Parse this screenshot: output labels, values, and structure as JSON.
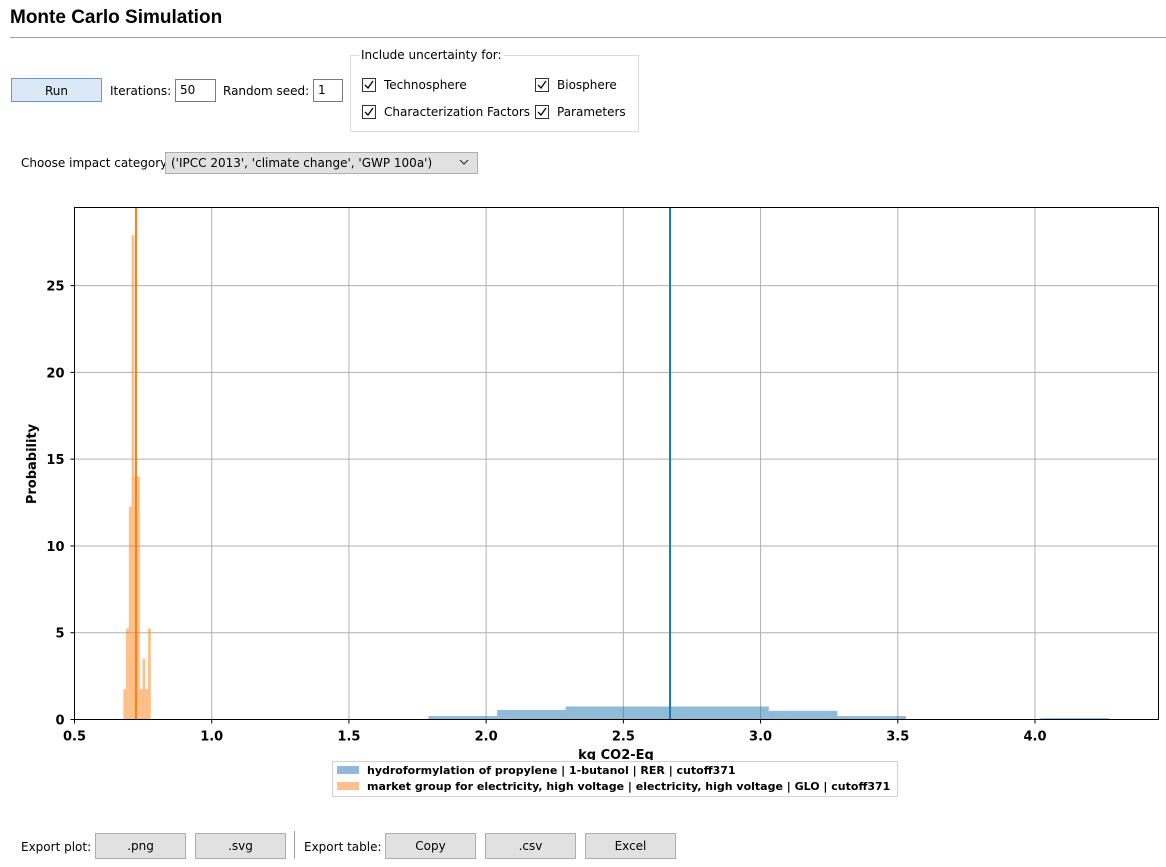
{
  "page": {
    "title": "Monte Carlo Simulation"
  },
  "controls": {
    "run_label": "Run",
    "iterations_label": "Iterations:",
    "iterations_value": "50",
    "seed_label": "Random seed:",
    "seed_value": "1"
  },
  "uncertainty": {
    "title": "Include uncertainty for:",
    "options": [
      {
        "label": "Technosphere",
        "checked": true
      },
      {
        "label": "Biosphere",
        "checked": true
      },
      {
        "label": "Characterization Factors",
        "checked": true
      },
      {
        "label": "Parameters",
        "checked": true
      }
    ]
  },
  "impact": {
    "label": "Choose impact category",
    "selected": "('IPCC 2013', 'climate change', 'GWP 100a')"
  },
  "export": {
    "plot_label": "Export plot:",
    "png_label": ".png",
    "svg_label": ".svg",
    "table_label": "Export table:",
    "copy_label": "Copy",
    "csv_label": ".csv",
    "excel_label": "Excel"
  },
  "chart_data": {
    "type": "bar",
    "xlabel": "kg CO2-Eq",
    "ylabel": "Probability",
    "xlim": [
      0.5,
      4.45
    ],
    "ylim": [
      0,
      29.5
    ],
    "xticks": [
      "0.5",
      "1.0",
      "1.5",
      "2.0",
      "2.5",
      "3.0",
      "3.5",
      "4.0"
    ],
    "yticks": [
      "0",
      "5",
      "10",
      "15",
      "20",
      "25"
    ],
    "grid": true,
    "legend_position": "bottom-center",
    "series": [
      {
        "name": "hydroformylation of propylene | 1-butanol | RER | cutoff371",
        "color": "#1f77b4",
        "mean": 2.67,
        "bins": [
          {
            "x0": 1.79,
            "x1": 2.04,
            "y": 0.2
          },
          {
            "x0": 2.04,
            "x1": 2.29,
            "y": 0.55
          },
          {
            "x0": 2.29,
            "x1": 3.03,
            "y": 0.75
          },
          {
            "x0": 3.03,
            "x1": 3.28,
            "y": 0.5
          },
          {
            "x0": 3.28,
            "x1": 3.53,
            "y": 0.2
          },
          {
            "x0": 4.02,
            "x1": 4.27,
            "y": 0.08
          }
        ]
      },
      {
        "name": "market group for electricity, high voltage | electricity, high voltage | GLO | cutoff371",
        "color": "#ff7f0e",
        "mean": 0.724,
        "bins": [
          {
            "x0": 0.678,
            "x1": 0.688,
            "y": 1.75
          },
          {
            "x0": 0.688,
            "x1": 0.698,
            "y": 5.25
          },
          {
            "x0": 0.698,
            "x1": 0.708,
            "y": 12.25
          },
          {
            "x0": 0.708,
            "x1": 0.718,
            "y": 27.9
          },
          {
            "x0": 0.718,
            "x1": 0.728,
            "y": 14.0
          },
          {
            "x0": 0.728,
            "x1": 0.738,
            "y": 14.0
          },
          {
            "x0": 0.738,
            "x1": 0.748,
            "y": 1.75
          },
          {
            "x0": 0.748,
            "x1": 0.758,
            "y": 3.5
          },
          {
            "x0": 0.758,
            "x1": 0.768,
            "y": 1.75
          },
          {
            "x0": 0.768,
            "x1": 0.778,
            "y": 5.25
          }
        ]
      }
    ]
  }
}
